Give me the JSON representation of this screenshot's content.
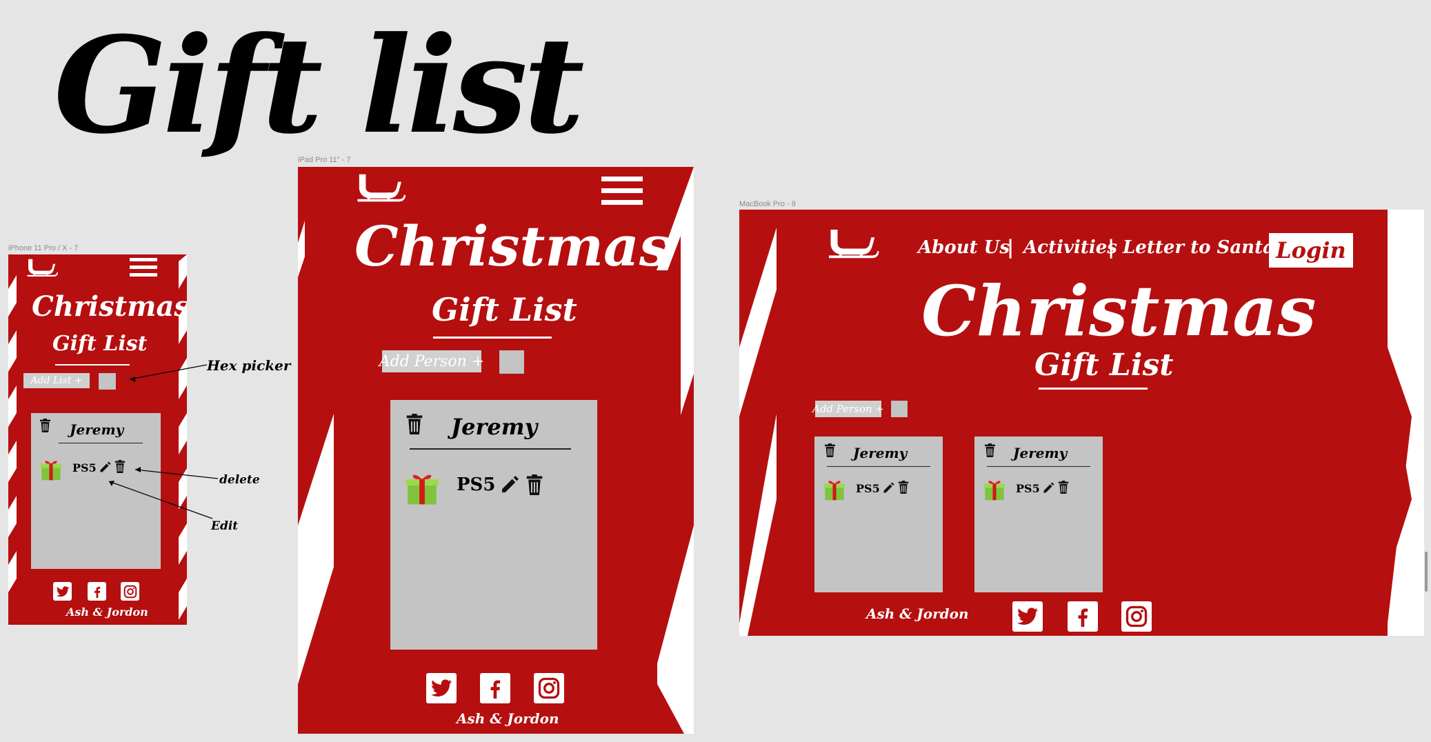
{
  "page_title": "Gift list",
  "colors": {
    "brand_red": "#b50f10",
    "card_gray": "#c4c4c4",
    "white": "#ffffff"
  },
  "frames": {
    "phone": {
      "label": "iPhone 11 Pro / X - 7",
      "title": "Christmas",
      "subtitle": "Gift List",
      "add_button": "Add List +",
      "card": {
        "person": "Jeremy",
        "item": "PS5"
      },
      "footer": "Ash & Jordon"
    },
    "tablet": {
      "label": "iPad Pro 11\" - 7",
      "title": "Christmas",
      "subtitle": "Gift List",
      "add_button": "Add Person +",
      "card": {
        "person": "Jeremy",
        "item": "PS5"
      },
      "footer": "Ash & Jordon"
    },
    "desktop": {
      "label": "MacBook Pro - 9",
      "nav": [
        "About Us",
        "Activities",
        "Letter to Santa"
      ],
      "nav_separator": "|",
      "login": "Login",
      "title": "Christmas",
      "subtitle": "Gift  List",
      "add_button": "Add Person +",
      "cards": [
        {
          "person": "Jeremy",
          "item": "PS5"
        },
        {
          "person": "Jeremy",
          "item": "PS5"
        }
      ],
      "footer": "Ash & Jordon"
    }
  },
  "annotations": {
    "hex_picker": "Hex picker",
    "delete": "delete",
    "edit": "Edit"
  },
  "icons": [
    "sleigh-icon",
    "hamburger-menu-icon",
    "trash-icon",
    "pencil-icon",
    "gift-icon",
    "twitter-icon",
    "facebook-icon",
    "instagram-icon"
  ]
}
